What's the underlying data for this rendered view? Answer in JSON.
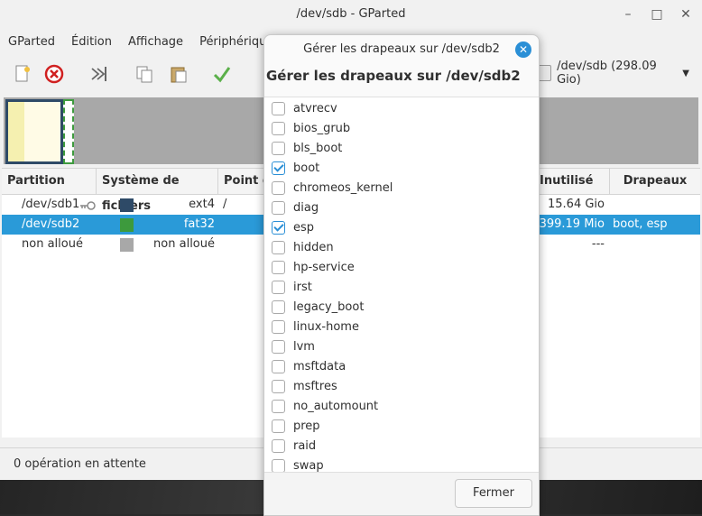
{
  "window": {
    "title": "/dev/sdb - GParted",
    "minimize_icon": "minimize-icon",
    "maximize_icon": "maximize-icon",
    "close_icon": "close-icon"
  },
  "menu": [
    "GParted",
    "Édition",
    "Affichage",
    "Périphérique"
  ],
  "device_selector": {
    "label": "/dev/sdb (298.09 Gio)"
  },
  "table": {
    "headers": {
      "partition": "Partition",
      "filesystem": "Système de fichiers",
      "mountpoint": "Point d",
      "unused": "Inutilisé",
      "flags": "Drapeaux"
    },
    "rows": [
      {
        "partition": "/dev/sdb1",
        "filesystem": "ext4",
        "color": "#2e4a67",
        "mountpoint": "/",
        "unused": "15.64 Gio",
        "flags": "",
        "key_icon": true,
        "selected": false
      },
      {
        "partition": "/dev/sdb2",
        "filesystem": "fat32",
        "color": "#3d9a3d",
        "mountpoint": "",
        "unused": "399.19 Mio",
        "flags": "boot, esp",
        "key_icon": false,
        "selected": true
      },
      {
        "partition": "non alloué",
        "filesystem": "non alloué",
        "color": "#a8a8a8",
        "mountpoint": "",
        "unused": "---",
        "flags": "",
        "key_icon": false,
        "selected": false
      }
    ]
  },
  "status": "0 opération en attente",
  "dialog": {
    "title": "Gérer les drapeaux sur /dev/sdb2",
    "heading": "Gérer les drapeaux sur /dev/sdb2",
    "close_button_label": "Fermer",
    "flags": [
      {
        "name": "atvrecv",
        "checked": false
      },
      {
        "name": "bios_grub",
        "checked": false
      },
      {
        "name": "bls_boot",
        "checked": false
      },
      {
        "name": "boot",
        "checked": true
      },
      {
        "name": "chromeos_kernel",
        "checked": false
      },
      {
        "name": "diag",
        "checked": false
      },
      {
        "name": "esp",
        "checked": true
      },
      {
        "name": "hidden",
        "checked": false
      },
      {
        "name": "hp-service",
        "checked": false
      },
      {
        "name": "irst",
        "checked": false
      },
      {
        "name": "legacy_boot",
        "checked": false
      },
      {
        "name": "linux-home",
        "checked": false
      },
      {
        "name": "lvm",
        "checked": false
      },
      {
        "name": "msftdata",
        "checked": false
      },
      {
        "name": "msftres",
        "checked": false
      },
      {
        "name": "no_automount",
        "checked": false
      },
      {
        "name": "prep",
        "checked": false
      },
      {
        "name": "raid",
        "checked": false
      },
      {
        "name": "swap",
        "checked": false
      }
    ]
  },
  "colors": {
    "accent": "#2a9ad8",
    "ext4": "#2e4a67",
    "fat32": "#3d9a3d",
    "unallocated": "#a8a8a8"
  }
}
